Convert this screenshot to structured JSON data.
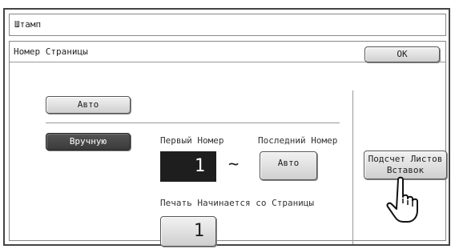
{
  "window": {
    "title": "Штамп"
  },
  "panel": {
    "title": "Номер Страницы",
    "ok_label": "OK"
  },
  "mode": {
    "auto_label": "Авто",
    "manual_label": "Вручную"
  },
  "numbering": {
    "first_label": "Первый Номер",
    "first_value": "1",
    "separator": "~",
    "last_label": "Последний Номер",
    "last_button_label": "Авто",
    "print_start_label": "Печать Начинается со Страницы",
    "print_start_value": "1"
  },
  "insert_button": {
    "line1": "Подсчет Листов",
    "line2": "Вставок"
  },
  "colors": {
    "selected_bg": "#3a3a3a",
    "number_box_bg": "#1e1e1e"
  },
  "icons": {
    "pointer": "hand-pointer-icon"
  }
}
